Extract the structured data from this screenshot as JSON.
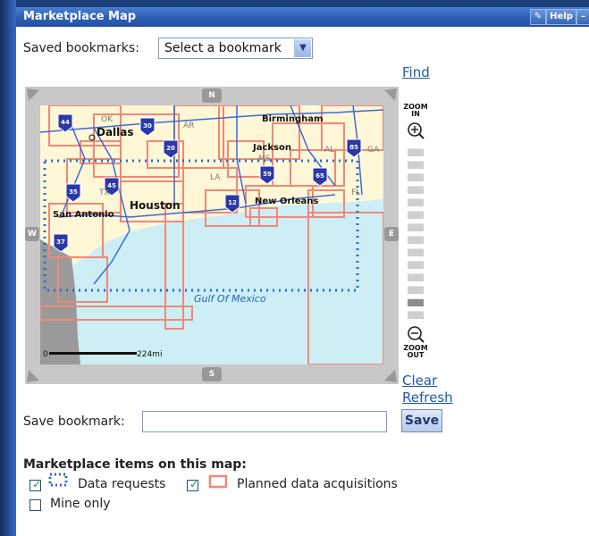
{
  "panel": {
    "title": "Marketplace Map",
    "edit_icon": "pencil-icon",
    "help_label": "Help",
    "minimize_label": "–"
  },
  "bookmarks": {
    "saved_label": "Saved bookmarks:",
    "select_value": "Select a bookmark"
  },
  "links": {
    "find": "Find",
    "clear": "Clear",
    "refresh": "Refresh"
  },
  "map": {
    "nav": {
      "north": "N",
      "south": "S",
      "west": "W",
      "east": "E"
    },
    "cities": [
      "Dallas",
      "Birmingham",
      "Jackson",
      "Houston",
      "San Antonio",
      "New Orleans"
    ],
    "states": [
      "OK",
      "AR",
      "AL",
      "GA",
      "MS",
      "TX",
      "LA",
      "FL"
    ],
    "highways": [
      "44",
      "30",
      "20",
      "85",
      "59",
      "65",
      "45",
      "35",
      "12",
      "37"
    ],
    "water_label": "Gulf Of Mexico",
    "scale_start": "0",
    "scale_end": "224mi"
  },
  "zoom": {
    "in_label": "ZOOM IN",
    "out_label": "ZOOM OUT",
    "level_index": 12,
    "segments": 14
  },
  "save": {
    "label": "Save bookmark:",
    "input_value": "",
    "button": "Save"
  },
  "legend": {
    "heading": "Marketplace items on this map:",
    "items": [
      {
        "label": "Data requests",
        "checked": true,
        "swatch": "dotted-blue"
      },
      {
        "label": "Planned data acquisitions",
        "checked": true,
        "swatch": "solid-red"
      },
      {
        "label": "Mine only",
        "checked": false
      }
    ]
  },
  "colors": {
    "titlebar": "#2d5fb3",
    "link": "#1f5aa9",
    "land": "#fff7d6",
    "water": "#cdeef5",
    "acquisition_red": "#f08878",
    "request_blue": "#2a6ad0"
  }
}
